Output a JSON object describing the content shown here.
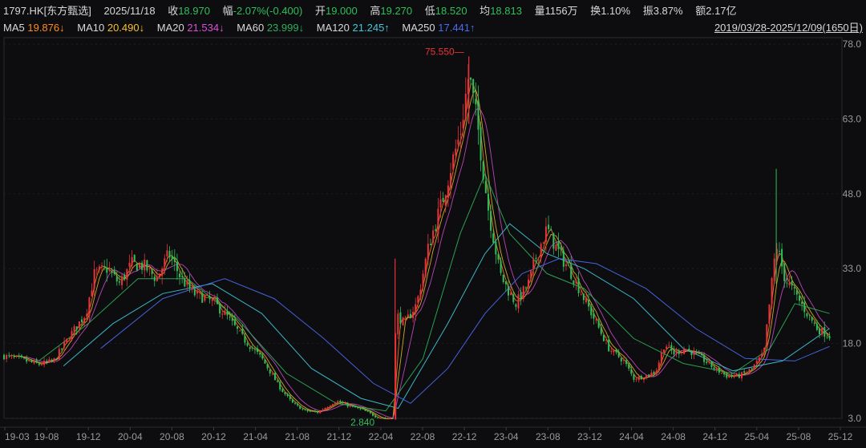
{
  "header": {
    "symbol": "1797.HK[东方甄选]",
    "date": "2025/11/18",
    "close_label": "收",
    "close": "18.970",
    "change_label": "幅",
    "change": "-2.07%(-0.400)",
    "open_label": "开",
    "open": "19.000",
    "high_label": "高",
    "high": "19.270",
    "low_label": "低",
    "low": "18.520",
    "avg_label": "均",
    "avg": "18.813",
    "vol_label": "量",
    "vol": "1156万",
    "turnover_label": "换",
    "turnover": "1.10%",
    "amp_label": "振",
    "amp": "3.87%",
    "amount_label": "额",
    "amount": "2.17亿"
  },
  "ma": [
    {
      "label": "MA5",
      "value": "19.876↓",
      "color": "#ff8c1a"
    },
    {
      "label": "MA10",
      "value": "20.490↓",
      "color": "#f2c12e"
    },
    {
      "label": "MA20",
      "value": "21.534↓",
      "color": "#d94fd6"
    },
    {
      "label": "MA60",
      "value": "23.999↓",
      "color": "#2fae5a"
    },
    {
      "label": "MA120",
      "value": "21.245↑",
      "color": "#3fc8d8"
    },
    {
      "label": "MA250",
      "value": "17.441↑",
      "color": "#4a6cf0"
    }
  ],
  "range": "2019/03/28-2025/12/09(1650日)",
  "colors": {
    "up": "#e8333a",
    "down": "#2fbf5a",
    "grid": "#1f1f24",
    "axis_text": "#9a9a9a"
  },
  "chart_data": {
    "type": "candlestick-line",
    "x_ticks": [
      "19-03",
      "19-08",
      "19-12",
      "20-04",
      "20-08",
      "20-12",
      "21-04",
      "21-08",
      "21-12",
      "22-04",
      "22-08",
      "22-12",
      "23-04",
      "23-08",
      "23-12",
      "24-04",
      "24-08",
      "24-12",
      "25-04",
      "25-08",
      "25-12"
    ],
    "y_ticks": [
      "78.0",
      "63.0",
      "48.0",
      "33.0",
      "18.0",
      "3.0"
    ],
    "ylim": [
      3.0,
      78.0
    ],
    "annotations": [
      {
        "text": "75.550",
        "x": 22.97,
        "y": 75.55,
        "color": "#e8333a",
        "kind": "max"
      },
      {
        "text": "2.840",
        "x": 22.3,
        "y": 2.84,
        "color": "#2fbf5a",
        "kind": "min"
      }
    ],
    "price_anchors": [
      [
        19.22,
        15.5
      ],
      [
        19.35,
        14.8
      ],
      [
        19.5,
        13.8
      ],
      [
        19.62,
        14.5
      ],
      [
        19.75,
        19.5
      ],
      [
        19.88,
        24
      ],
      [
        19.95,
        32
      ],
      [
        20.05,
        33
      ],
      [
        20.15,
        30
      ],
      [
        20.25,
        34
      ],
      [
        20.35,
        33.5
      ],
      [
        20.45,
        31
      ],
      [
        20.55,
        36
      ],
      [
        20.65,
        31
      ],
      [
        20.75,
        28
      ],
      [
        20.85,
        27
      ],
      [
        20.92,
        26
      ],
      [
        21.0,
        24
      ],
      [
        21.15,
        19
      ],
      [
        21.3,
        15
      ],
      [
        21.45,
        9
      ],
      [
        21.55,
        6
      ],
      [
        21.65,
        4.5
      ],
      [
        21.75,
        4.2
      ],
      [
        21.9,
        6.5
      ],
      [
        22.0,
        5.5
      ],
      [
        22.1,
        4.8
      ],
      [
        22.22,
        3.4
      ],
      [
        22.3,
        2.84
      ],
      [
        22.37,
        3.3
      ],
      [
        22.38,
        24
      ],
      [
        22.45,
        22
      ],
      [
        22.55,
        26
      ],
      [
        22.65,
        38
      ],
      [
        22.75,
        46
      ],
      [
        22.82,
        53
      ],
      [
        22.9,
        60
      ],
      [
        22.97,
        72
      ],
      [
        23.05,
        60
      ],
      [
        23.12,
        46
      ],
      [
        23.22,
        32
      ],
      [
        23.28,
        29
      ],
      [
        23.35,
        26
      ],
      [
        23.45,
        30
      ],
      [
        23.52,
        36
      ],
      [
        23.6,
        41
      ],
      [
        23.7,
        36
      ],
      [
        23.8,
        32
      ],
      [
        23.9,
        27
      ],
      [
        24.0,
        22
      ],
      [
        24.1,
        17
      ],
      [
        24.22,
        14.5
      ],
      [
        24.3,
        11
      ],
      [
        24.4,
        11.5
      ],
      [
        24.48,
        12.5
      ],
      [
        24.55,
        18
      ],
      [
        24.62,
        16
      ],
      [
        24.72,
        17
      ],
      [
        24.85,
        15
      ],
      [
        24.95,
        13
      ],
      [
        25.05,
        11.5
      ],
      [
        25.15,
        11.5
      ],
      [
        25.25,
        12.8
      ],
      [
        25.35,
        16
      ],
      [
        25.45,
        38
      ],
      [
        25.52,
        31
      ],
      [
        25.6,
        28
      ],
      [
        25.7,
        24
      ],
      [
        25.78,
        21
      ],
      [
        25.88,
        19.5
      ]
    ],
    "ma_series": [
      {
        "name": "MA60",
        "color": "#2fae5a",
        "points": [
          [
            19.5,
            14.5
          ],
          [
            19.9,
            22
          ],
          [
            20.3,
            31
          ],
          [
            20.7,
            31
          ],
          [
            21.1,
            23
          ],
          [
            21.5,
            12
          ],
          [
            21.9,
            6
          ],
          [
            22.3,
            4.5
          ],
          [
            22.6,
            15
          ],
          [
            22.9,
            40
          ],
          [
            23.1,
            52
          ],
          [
            23.3,
            40
          ],
          [
            23.6,
            32
          ],
          [
            23.9,
            29
          ],
          [
            24.3,
            19
          ],
          [
            24.7,
            14
          ],
          [
            25.1,
            12
          ],
          [
            25.4,
            17
          ],
          [
            25.6,
            26
          ],
          [
            25.88,
            24
          ]
        ]
      },
      {
        "name": "MA120",
        "color": "#3fc8d8",
        "points": [
          [
            19.7,
            13.5
          ],
          [
            20.1,
            22
          ],
          [
            20.5,
            28
          ],
          [
            20.9,
            30
          ],
          [
            21.3,
            24
          ],
          [
            21.7,
            13
          ],
          [
            22.1,
            7
          ],
          [
            22.4,
            5
          ],
          [
            22.8,
            22
          ],
          [
            23.1,
            36
          ],
          [
            23.3,
            42
          ],
          [
            23.6,
            36
          ],
          [
            23.9,
            33
          ],
          [
            24.3,
            27
          ],
          [
            24.7,
            17
          ],
          [
            25.1,
            12.5
          ],
          [
            25.5,
            14.5
          ],
          [
            25.88,
            21
          ]
        ]
      },
      {
        "name": "MA250",
        "color": "#4a6cf0",
        "points": [
          [
            20.0,
            17
          ],
          [
            20.5,
            27
          ],
          [
            21.0,
            31
          ],
          [
            21.4,
            27
          ],
          [
            21.8,
            19
          ],
          [
            22.2,
            10
          ],
          [
            22.5,
            6
          ],
          [
            22.8,
            13
          ],
          [
            23.1,
            24
          ],
          [
            23.4,
            32
          ],
          [
            23.7,
            35
          ],
          [
            24.0,
            34
          ],
          [
            24.4,
            29
          ],
          [
            24.8,
            21
          ],
          [
            25.2,
            15
          ],
          [
            25.6,
            14.5
          ],
          [
            25.88,
            17.4
          ]
        ]
      }
    ]
  }
}
